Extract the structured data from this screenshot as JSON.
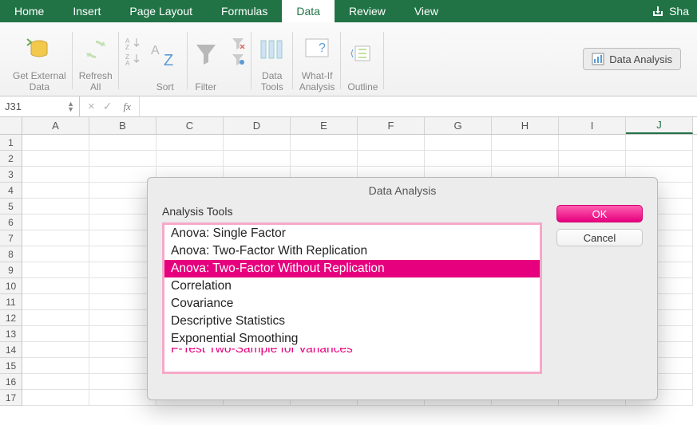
{
  "ribbon": {
    "tabs": [
      "Home",
      "Insert",
      "Page Layout",
      "Formulas",
      "Data",
      "Review",
      "View"
    ],
    "active": "Data",
    "share": "Sha"
  },
  "toolbar": {
    "get_external_data": "Get External\nData",
    "refresh_all": "Refresh\nAll",
    "sort": "Sort",
    "filter": "Filter",
    "data_tools": "Data\nTools",
    "what_if": "What-If\nAnalysis",
    "outline": "Outline",
    "data_analysis": "Data Analysis"
  },
  "formula_bar": {
    "name_box": "J31",
    "fx": "fx",
    "value": ""
  },
  "grid": {
    "columns": [
      "A",
      "B",
      "C",
      "D",
      "E",
      "F",
      "G",
      "H",
      "I",
      "J"
    ],
    "selected_column": "J",
    "rows": [
      1,
      2,
      3,
      4,
      5,
      6,
      7,
      8,
      9,
      10,
      11,
      12,
      13,
      14,
      15,
      16,
      17
    ]
  },
  "dialog": {
    "title": "Data Analysis",
    "list_label": "Analysis Tools",
    "items": [
      "Anova: Single Factor",
      "Anova: Two-Factor With Replication",
      "Anova: Two-Factor Without Replication",
      "Correlation",
      "Covariance",
      "Descriptive Statistics",
      "Exponential Smoothing",
      "F-Test Two-Sample for Variances"
    ],
    "selected_index": 2,
    "ok": "OK",
    "cancel": "Cancel"
  }
}
